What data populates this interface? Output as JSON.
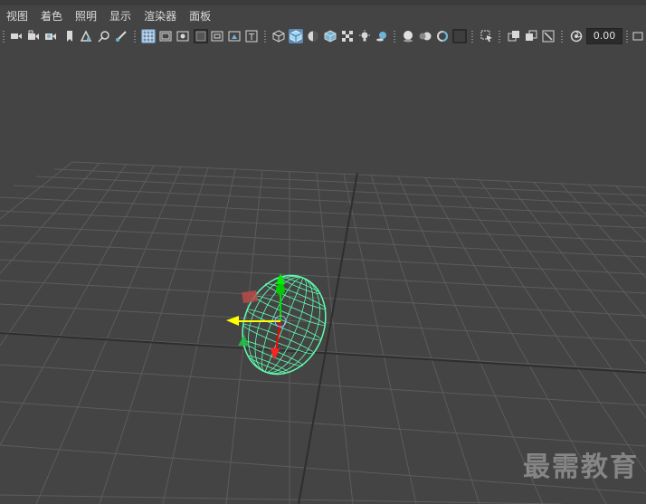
{
  "menubar": {
    "items": [
      {
        "label": "视图"
      },
      {
        "label": "着色"
      },
      {
        "label": "照明"
      },
      {
        "label": "显示"
      },
      {
        "label": "渲染器"
      },
      {
        "label": "面板"
      }
    ]
  },
  "toolbar": {
    "camera_value": "0.00"
  },
  "viewport": {
    "object": "sphere-wireframe",
    "wire_color": "#5fffb0",
    "grid_color": "#5a5a5a"
  },
  "watermark": {
    "text": "最需教育"
  }
}
